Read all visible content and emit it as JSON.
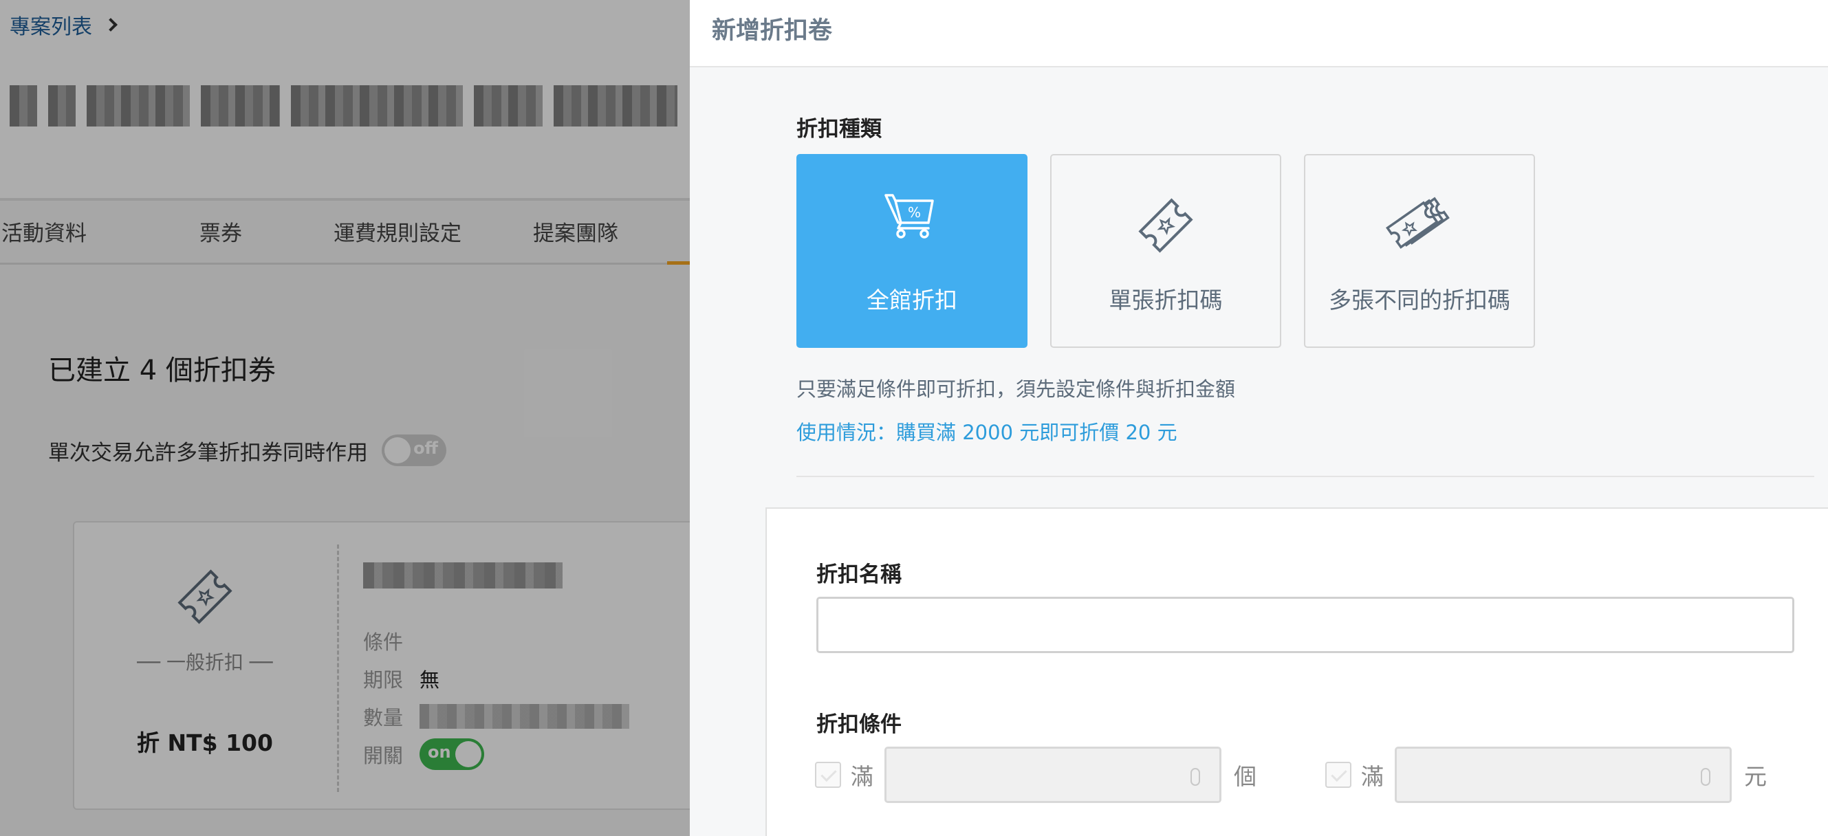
{
  "background_page": {
    "breadcrumb": {
      "label": "專案列表"
    },
    "tabs": [
      {
        "label": "活動資料"
      },
      {
        "label": "票券"
      },
      {
        "label": "運費規則設定"
      },
      {
        "label": "提案團隊"
      }
    ],
    "coupon_count_title": "已建立 4 個折扣券",
    "multi_use_label": "單次交易允許多筆折扣券同時作用",
    "multi_use_toggle": "off",
    "coupon_card": {
      "type_label": "── 一般折扣 ──",
      "amount": "折 NT$ 100",
      "condition_label": "條件",
      "period_label": "期限",
      "period_value": "無",
      "quantity_label": "數量",
      "switch_label": "開關",
      "switch_value": "on",
      "icon": "ticket-icon"
    }
  },
  "drawer": {
    "title": "新增折扣卷",
    "discount_type_label": "折扣種類",
    "types": [
      {
        "label": "全館折扣",
        "icon": "cart-percent-icon",
        "active": true
      },
      {
        "label": "單張折扣碼",
        "icon": "ticket-icon",
        "active": false
      },
      {
        "label": "多張不同的折扣碼",
        "icon": "multi-ticket-icon",
        "active": false
      }
    ],
    "description": "只要滿足條件即可折扣，須先設定條件與折扣金額",
    "usage": "使用情況：購買滿 2000 元即可折價 20 元",
    "name_label": "折扣名稱",
    "name_value": "",
    "condition_label": "折扣條件",
    "conditions": [
      {
        "prefix": "滿",
        "unit": "個"
      },
      {
        "prefix": "滿",
        "unit": "元"
      }
    ],
    "colors": {
      "accent": "#42aef0",
      "usage_text": "#2d9cdb",
      "toggle_on": "#3fb950"
    }
  }
}
